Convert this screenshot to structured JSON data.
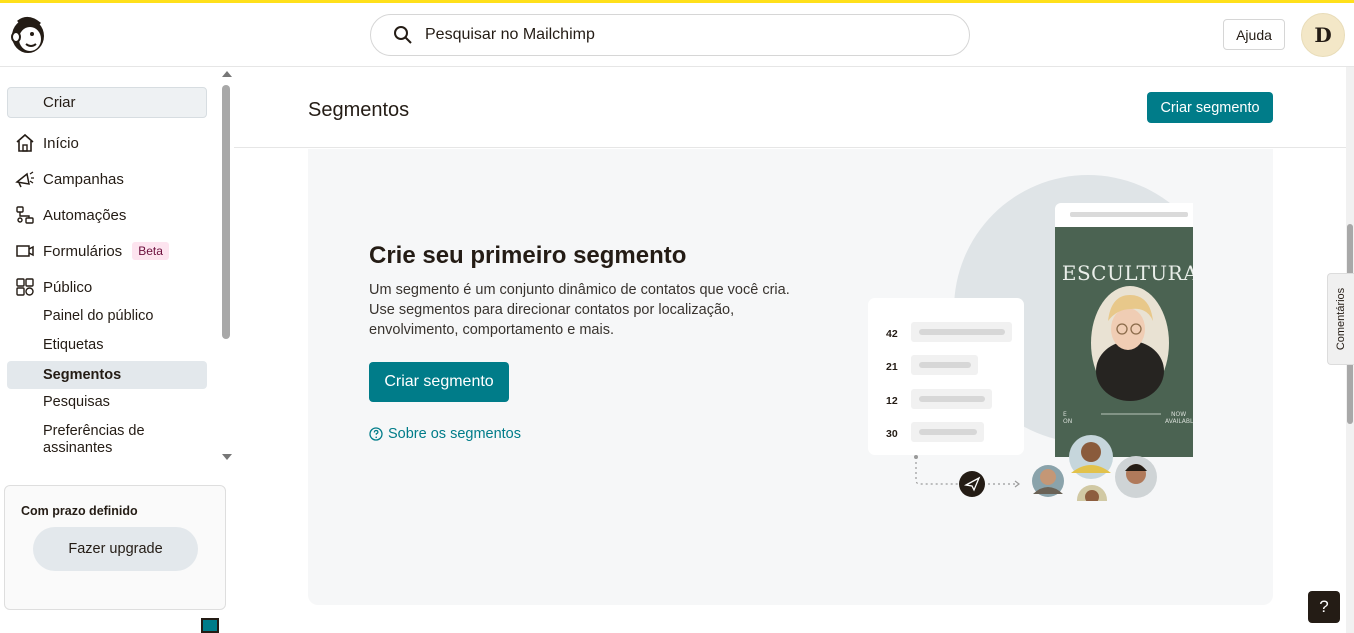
{
  "header": {
    "search_placeholder": "Pesquisar no Mailchimp",
    "help_label": "Ajuda",
    "avatar_initial": "D"
  },
  "sidebar": {
    "create_label": "Criar",
    "items": [
      {
        "label": "Início",
        "icon": "home-icon"
      },
      {
        "label": "Campanhas",
        "icon": "megaphone-icon"
      },
      {
        "label": "Automações",
        "icon": "automations-icon"
      },
      {
        "label": "Formulários",
        "icon": "forms-icon",
        "badge": "Beta"
      },
      {
        "label": "Público",
        "icon": "audience-icon"
      }
    ],
    "sub_items": [
      {
        "label": "Painel do público"
      },
      {
        "label": "Etiquetas"
      },
      {
        "label": "Segmentos",
        "active": true
      },
      {
        "label": "Pesquisas"
      },
      {
        "label": "Preferências de assinantes"
      }
    ],
    "plan_title": "Com prazo definido",
    "upgrade_label": "Fazer upgrade"
  },
  "main": {
    "title": "Segmentos",
    "header_button": "Criar segmento",
    "empty": {
      "title": "Crie seu primeiro segmento",
      "description": "Um segmento é um conjunto dinâmico de contatos que você cria. Use segmentos para direcionar contatos por localização, envolvimento, comportamento e mais.",
      "button": "Criar segmento",
      "link": "Sobre os segmentos"
    },
    "illustration": {
      "poster_title": "ESCULTURA",
      "poster_footer_left": "E\nON",
      "poster_footer_right": "NOW\nAVAILABLE",
      "counts": [
        "42",
        "21",
        "12",
        "30"
      ]
    }
  },
  "feedback_label": "Comentários",
  "help_fab": "?",
  "colors": {
    "brand_yellow": "#ffe01b",
    "teal": "#007c89",
    "poster_green": "#4b6352"
  }
}
